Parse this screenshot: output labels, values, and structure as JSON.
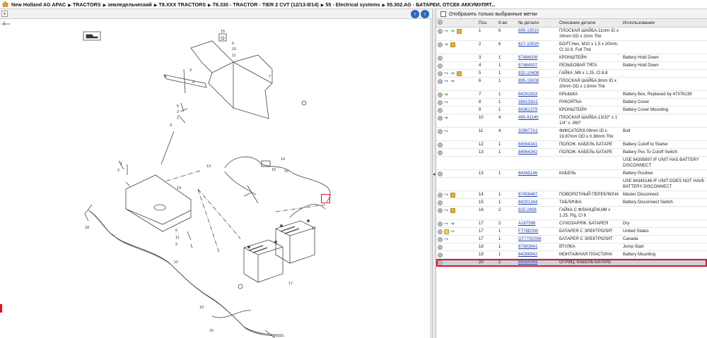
{
  "breadcrumb": [
    {
      "label": "New Holland AG APAC",
      "bold": true
    },
    {
      "label": "TRACTORS",
      "bold": true
    },
    {
      "label": "земледельческий",
      "bold": true
    },
    {
      "label": "T8.XXX TRACTORS",
      "bold": true
    },
    {
      "label": "T8.330 - TRACTOR - TIER 2 CVT (12/13-8/14)",
      "bold": true
    },
    {
      "label": "55 - Electrical systems",
      "bold": true
    },
    {
      "label": "55.302.AG - БАТАРЕИ, ОТСЕК АККУМУЛЯТ...",
      "bold": true
    }
  ],
  "toolbar": {
    "zoom_in": "+",
    "prev": "‹",
    "next": "›"
  },
  "filter": {
    "label": "Отобразить только выбранные метки"
  },
  "columns": [
    "",
    "Поз.",
    "К-во",
    "№ детали",
    "Описание детали",
    "Использование"
  ],
  "rows": [
    {
      "icons": [
        "gray",
        "blue",
        "green",
        "box"
      ],
      "pos": "1",
      "qty": "6",
      "part": "895-15010",
      "desc": "ПЛОСКАЯ ШАЙБА,11mm ID x 24mm OD x 2mm Thk",
      "usage": ""
    },
    {
      "icons": [
        "gray",
        "green",
        "box"
      ],
      "pos": "2",
      "qty": "6",
      "part": "627-10020",
      "desc": "БОЛТ,Hex, M10 x 1.5 x 20mm, Cl 10.9, Full Thd",
      "usage": ""
    },
    {
      "icons": [
        "gray"
      ],
      "pos": "3",
      "qty": "1",
      "part": "87484008",
      "desc": "КРОНШТЕЙН",
      "usage": "Battery Hold Down"
    },
    {
      "icons": [
        "gray"
      ],
      "pos": "4",
      "qty": "1",
      "part": "87484007",
      "desc": "РЕЗЬБОВАЯ ТЯГА",
      "usage": "Battery Hold Down"
    },
    {
      "icons": [
        "gray",
        "blue",
        "green",
        "box"
      ],
      "pos": "5",
      "qty": "1",
      "part": "832-10408",
      "desc": "ГАЙКА ,M8 x 1.25, Cl 8.8",
      "usage": ""
    },
    {
      "icons": [
        "gray",
        "blue",
        "green"
      ],
      "pos": "6",
      "qty": "1",
      "part": "895-15008",
      "desc": "ПЛОСКАЯ ШАЙБА,9mm ID x 20mm OD x 1.6mm Thk",
      "usage": ""
    },
    {
      "icons": [
        "gray",
        "green"
      ],
      "pos": "7",
      "qty": "1",
      "part": "84291833",
      "desc": "КРЫШКА",
      "usage": "Battery Box, Replaced by 47376139"
    },
    {
      "icons": [
        "gray",
        "blue"
      ],
      "pos": "8",
      "qty": "1",
      "part": "394133A1",
      "desc": "РУКОЯТКА",
      "usage": "Battery Cover"
    },
    {
      "icons": [
        "gray"
      ],
      "pos": "9",
      "qty": "1",
      "part": "84361379",
      "desc": "КРОНШТЕЙН",
      "usage": "Battery Cover Mounting"
    },
    {
      "icons": [
        "gray",
        "green"
      ],
      "pos": "10",
      "qty": "4",
      "part": "495-81140",
      "desc": "ПЛОСКАЯ ШАЙБА,13/32\" x 1 1/4\" x .060\"",
      "usage": ""
    },
    {
      "icons": [
        "gray",
        "blue"
      ],
      "pos": "11",
      "qty": "4",
      "part": "329677A1",
      "desc": "ФИКСАТОР,9.09mm ID x 19.87mm OD x 0.38mm Thk",
      "usage": "Bolt"
    },
    {
      "icons": [
        "gray"
      ],
      "pos": "12",
      "qty": "1",
      "part": "84564341",
      "desc": "ПОЛОЖ. КАБЕЛЬ БАТАРЕ",
      "usage": "Battery Cutoff to Starter"
    },
    {
      "icons": [
        "gray"
      ],
      "pos": "13",
      "qty": "1",
      "part": "84564342",
      "desc": "ПОЛОЖ. КАБЕЛЬ БАТАРЕ",
      "usage": "Battery Pos To Cutoff Switch"
    },
    {
      "icons": [],
      "pos": "",
      "qty": "",
      "part": "",
      "desc": "",
      "usage": "USE 84395697 IF UNIT HAS BATTERY DISCONNECT"
    },
    {
      "icons": [
        "gray"
      ],
      "pos": "13",
      "qty": "1",
      "part": "84345146",
      "desc": "КАБЕЛЬ",
      "usage": "Battery Positive"
    },
    {
      "icons": [],
      "pos": "",
      "qty": "",
      "part": "",
      "desc": "",
      "usage": "USE 84345146 IF UNIT DOES NOT HAVE BATTERY DISCONNECT"
    },
    {
      "icons": [
        "gray",
        "blue",
        "box"
      ],
      "pos": "14",
      "qty": "1",
      "part": "87458467",
      "desc": "ПОВОРОТНЫЙ ПЕРЕКЛЮЧА",
      "usage": "Master Disconnect"
    },
    {
      "icons": [
        "gray"
      ],
      "pos": "15",
      "qty": "1",
      "part": "84291344",
      "desc": "ТАБЛИЧКА",
      "usage": "Battery Disconnect Switch"
    },
    {
      "icons": [
        "gray",
        "blue",
        "box"
      ],
      "pos": "16",
      "qty": "2",
      "part": "825-2408",
      "desc": "ГАЙКА С ФЛАНЦЕМ,M8 x 1.25, Flg, Cl 8",
      "usage": ""
    },
    {
      "icons": [
        "gray",
        "blue",
        "green"
      ],
      "pos": "17",
      "qty": "2",
      "part": "A187596",
      "desc": "СУХОЗАРЯЖ. БАТАРЕЯ",
      "usage": "Dry"
    },
    {
      "icons": [
        "gray",
        "note",
        "blue"
      ],
      "pos": "17",
      "qty": "1",
      "part": "F778DSW",
      "desc": "БАТАРЕЯ С ЭЛЕКТРОЛИТ",
      "usage": "United States"
    },
    {
      "icons": [
        "gray",
        "blue"
      ],
      "pos": "17",
      "qty": "1",
      "part": "CF770DSW",
      "desc": "БАТАРЕЯ С ЭЛЕКТРОЛИТ",
      "usage": "Canada"
    },
    {
      "icons": [
        "gray"
      ],
      "pos": "18",
      "qty": "1",
      "part": "87383841",
      "desc": "ВТУЛКА",
      "usage": "Jump Start"
    },
    {
      "icons": [
        "gray"
      ],
      "pos": "19",
      "qty": "1",
      "part": "84266942",
      "desc": "МОНТАЖНАЯ ПЛАСТИНА",
      "usage": "Battery Mounting"
    },
    {
      "icons": [
        "gray"
      ],
      "pos": "20",
      "qty": "1",
      "part": "84564344",
      "desc": "ОТРИЦ. КАБЕЛЬ БАТАРЕ",
      "usage": "",
      "selected": true
    }
  ],
  "diagram": {
    "callouts": [
      "1",
      "2",
      "3",
      "4",
      "5",
      "6",
      "7",
      "8",
      "9",
      "10",
      "11",
      "12",
      "13",
      "14",
      "15",
      "16",
      "17",
      "18",
      "19",
      "20"
    ],
    "selected_callout": "20"
  }
}
